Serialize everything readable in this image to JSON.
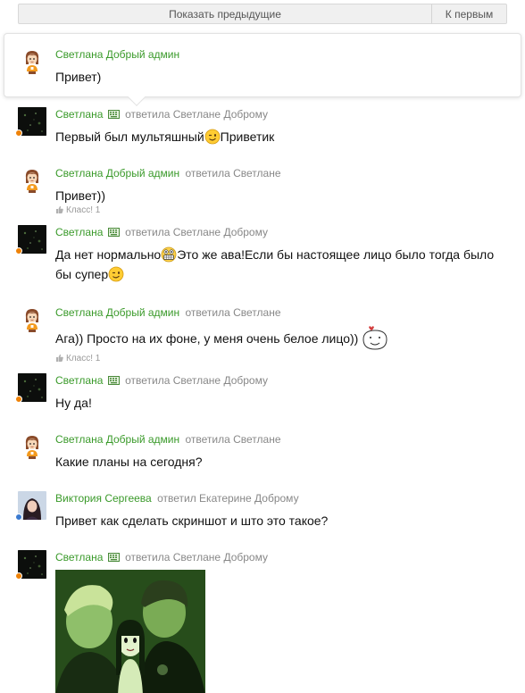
{
  "topbar": {
    "show_previous": "Показать предыдущие",
    "to_first": "К первым"
  },
  "replied_word_f": "ответила",
  "replied_word_m": "ответил",
  "messages": [
    {
      "author": "Светлана Добрый админ",
      "text": "Привет)"
    },
    {
      "author": "Светлана",
      "target": "Светлане Доброму",
      "text_a": "Первый был мультяшный",
      "text_b": "Приветик"
    },
    {
      "author": "Светлана Добрый админ",
      "target": "Светлане",
      "text": "Привет))",
      "likes": "Класс! 1"
    },
    {
      "author": "Светлана",
      "target": "Светлане Доброму",
      "text_a": "Да нет нормально",
      "text_b": "Это же ава!Если бы настоящее лицо было тогда было бы супер"
    },
    {
      "author": "Светлана Добрый админ",
      "target": "Светлане",
      "text": "Ага)) Просто на их фоне, у меня очень белое лицо))",
      "likes": "Класс! 1"
    },
    {
      "author": "Светлана",
      "target": "Светлане Доброму",
      "text": "Ну да!"
    },
    {
      "author": "Светлана Добрый админ",
      "target": "Светлане",
      "text": "Какие планы на сегодня?"
    },
    {
      "author": "Виктория Сергеева",
      "target": "Екатерине Доброму",
      "text": "Привет как сделать скриншот и што это такое?"
    },
    {
      "author": "Светлана",
      "target": "Светлане Доброму"
    }
  ],
  "colors": {
    "author": "#3a9a2a",
    "online_dot": "#ee8208",
    "online_dot_mobile": "#3b7ad0"
  },
  "icons": [
    "girl-avatar-icon",
    "camera-avatar-icon",
    "keyboard-icon",
    "wink-smiley-icon",
    "grin-smiley-icon",
    "kiss-smiley-icon",
    "thumb-up-icon"
  ]
}
